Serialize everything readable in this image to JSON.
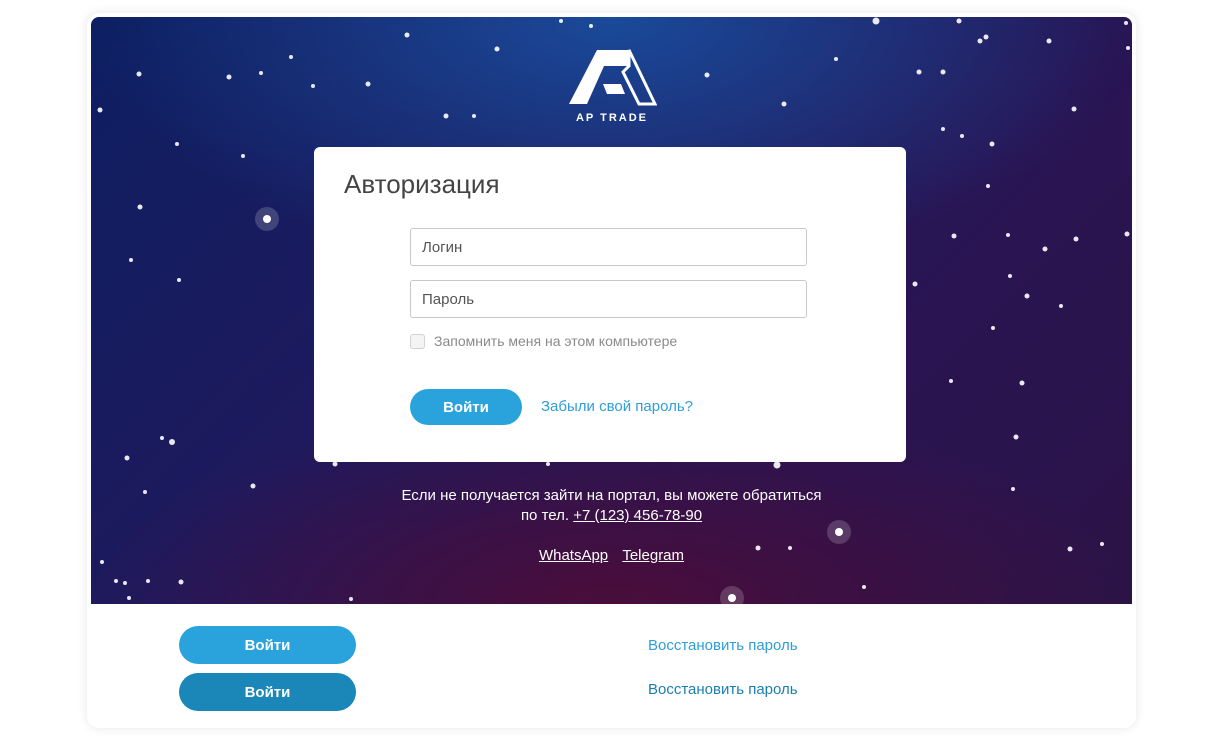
{
  "brand": {
    "name": "AP TRADE"
  },
  "login_card": {
    "title": "Авторизация",
    "login_placeholder": "Логин",
    "password_placeholder": "Пароль",
    "remember_label": "Запомнить меня на этом компьютере",
    "remember_checked": false,
    "submit_label": "Войти",
    "forgot_label": "Забыли свой пароль?"
  },
  "help": {
    "line1": "Если не получается зайти на портал, вы можете обратиться",
    "line2_prefix": "по тел.",
    "phone": "+7 (123) 456-78-90",
    "whatsapp": "WhatsApp",
    "telegram": "Telegram"
  },
  "variants": {
    "button_1_label": "Войти",
    "button_2_label": "Войти",
    "link_1_label": "Восстановить пароль",
    "link_2_label": "Восстановить пароль"
  },
  "colors": {
    "accent": "#2aa3dd",
    "accent_dark": "#1b87b9",
    "link": "#2f9ed8"
  }
}
